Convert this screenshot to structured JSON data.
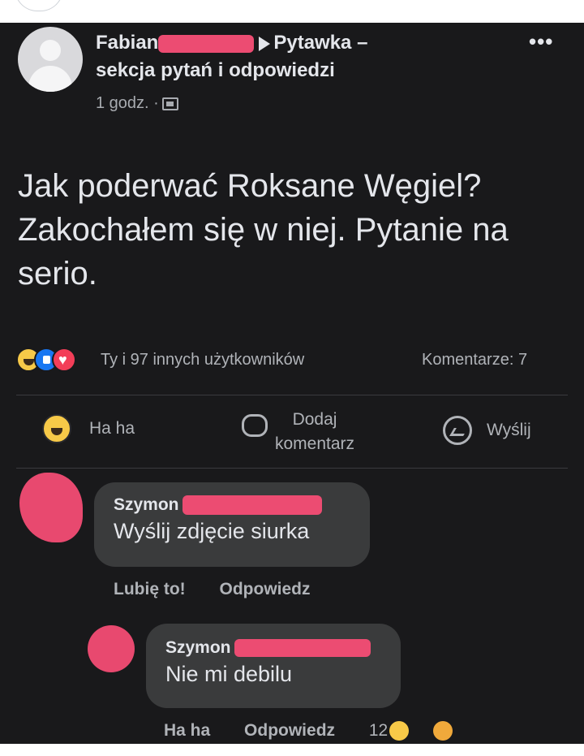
{
  "post": {
    "author": "Fabian",
    "group": "Pytawka –",
    "group_line2": "sekcja pytań i odpowiedzi",
    "time": "1 godz. ·",
    "more_label": "•••",
    "text": "Jak poderwać Roksane Węgiel? Zakochałem się w niej. Pytanie na serio."
  },
  "reactions": {
    "icons": [
      "haha",
      "like",
      "love"
    ],
    "summary": "Ty i 97 innych użytkowników",
    "comments": "Komentarze: 7"
  },
  "actions": {
    "reaction_label": "Ha ha",
    "comment_label_1": "Dodaj",
    "comment_label_2": "komentarz",
    "send_label": "Wyślij"
  },
  "comments": [
    {
      "author": "Szymon",
      "text": "Wyślij zdjęcie siurka",
      "like_label": "Lubię to!",
      "reply_label": "Odpowiedz"
    },
    {
      "author": "Szymon",
      "text": "Nie mi debilu",
      "reaction_label": "Ha ha",
      "reply_label": "Odpowiedz",
      "reaction_count": "12"
    }
  ],
  "colors": {
    "background": "#19191b",
    "text": "#e4e6eb",
    "secondary": "#b0b3b8",
    "bubble": "#3a3b3c",
    "redaction": "#ec4c72"
  }
}
